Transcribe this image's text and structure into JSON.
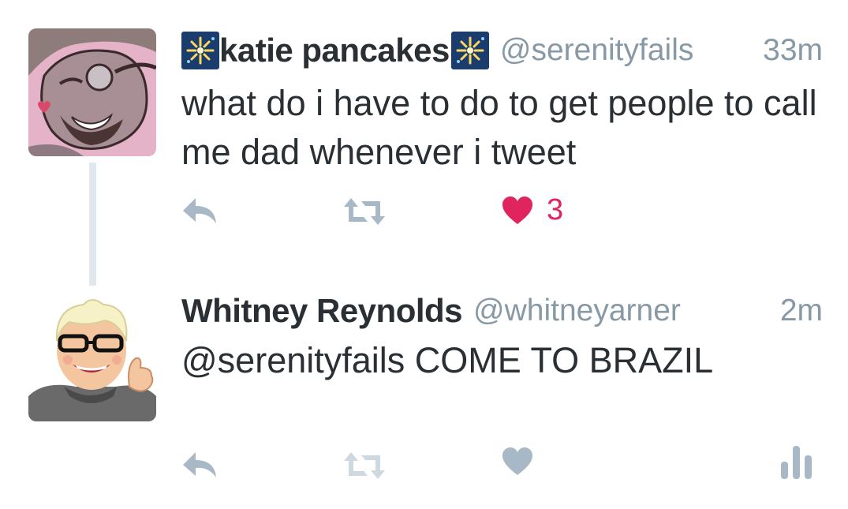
{
  "tweets": [
    {
      "display_name": "katie pancakes",
      "handle": "@serenityfails",
      "time": "33m",
      "text": "what do i have to do to get people to call me dad whenever i tweet",
      "emoji": "fireworks-emoji",
      "like_count": "3",
      "liked": true,
      "avatar": "bearded-man-illustration"
    },
    {
      "display_name": "Whitney Reynolds",
      "handle": "@whitneyarner",
      "time": "2m",
      "text": "@serenityfails COME TO BRAZIL",
      "liked": false,
      "avatar": "cartoon-thumbs-up-illustration"
    }
  ],
  "colors": {
    "name": "#292f33",
    "meta": "#8899a6",
    "icon": "#a8b8c6",
    "like": "#e0245e",
    "thread_line": "#e1e8ed"
  },
  "icons": [
    "reply-icon",
    "retweet-icon",
    "heart-icon",
    "analytics-icon"
  ]
}
